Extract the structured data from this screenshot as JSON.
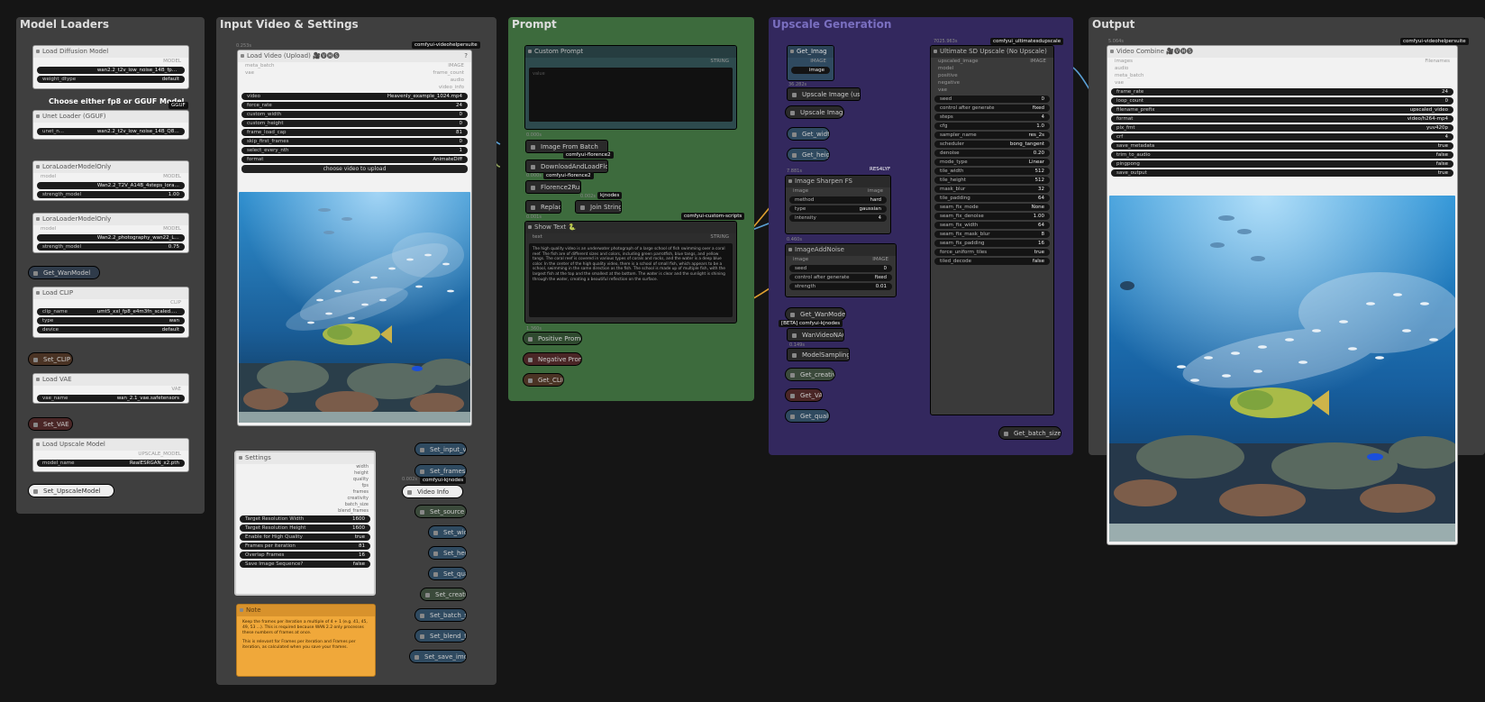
{
  "groups": {
    "model_loaders": "Model Loaders",
    "input_video": "Input Video & Settings",
    "prompt": "Prompt",
    "upscale": "Upscale Generation",
    "output": "Output"
  },
  "model_loaders": {
    "load_diffusion": {
      "title": "Load Diffusion Model",
      "out": "MODEL",
      "unet_name": "wan2.2_t2v_low_noise_14B_fp8_scaled.safetensors",
      "weight_dtype_label": "weight_dtype",
      "weight_dtype": "default"
    },
    "gguf_heading": "Choose either fp8 or GGUF Model",
    "gguf_badge": "GGUF",
    "unet_loader": {
      "title": "Unet Loader (GGUF)",
      "unet_name_label": "unet_n...",
      "unet_name": "wan2.2_t2v_low_noise_14B_Q8_0.gguf"
    },
    "lora1": {
      "title": "LoraLoaderModelOnly",
      "model_label": "model",
      "out": "MODEL",
      "lora_name": "Wan2.2_T2V_A14B_4steps_lora_250928_low_rank",
      "strength_label": "strength_model",
      "strength": "1.00"
    },
    "lora2": {
      "title": "LoraLoaderModelOnly",
      "model_label": "model",
      "out": "MODEL",
      "lora_name": "Wan2.2_photography_wan22_LOW_v1.safetensors",
      "strength_label": "strength_model",
      "strength": "0.75"
    },
    "get_wanmodel": "Get_WanModel",
    "load_clip": {
      "title": "Load CLIP",
      "out": "CLIP",
      "clip_name_label": "clip_name",
      "clip_name": "umt5_xxl_fp8_e4m3fn_scaled.safetensors",
      "type_label": "type",
      "type": "wan",
      "device_label": "device",
      "device": "default"
    },
    "set_clip": "Set_CLIP",
    "load_vae": {
      "title": "Load VAE",
      "out": "VAE",
      "vae_name_label": "vae_name",
      "vae_name": "wan_2.1_vae.safetensors"
    },
    "set_vae": "Set_VAE",
    "load_upscale": {
      "title": "Load Upscale Model",
      "out": "UPSCALE_MODEL",
      "model_name_label": "model_name",
      "model_name": "RealESRGAN_x2.pth"
    },
    "set_upscale": "Set_UpscaleModel"
  },
  "input": {
    "load_video": {
      "time": "0.253s",
      "badge": "comfyui-videohelpersuite",
      "title": "Load Video (Upload) 🎥🅥🅗🅢",
      "help": "?",
      "sock_left": [
        "meta_batch",
        "vae"
      ],
      "sock_right": [
        "IMAGE",
        "frame_count",
        "audio",
        "video_info"
      ],
      "widgets": [
        {
          "k": "video",
          "v": "Heavenly_example_1024.mp4"
        },
        {
          "k": "force_rate",
          "v": "24"
        },
        {
          "k": "custom_width",
          "v": "0"
        },
        {
          "k": "custom_height",
          "v": "0"
        },
        {
          "k": "frame_load_cap",
          "v": "81"
        },
        {
          "k": "skip_first_frames",
          "v": "0"
        },
        {
          "k": "select_every_nth",
          "v": "1"
        },
        {
          "k": "format",
          "v": "AnimateDiff"
        }
      ],
      "upload_label": "choose video to upload"
    },
    "settings": {
      "title": "Settings",
      "outs": [
        "width",
        "height",
        "quality",
        "fps",
        "frames",
        "creativity",
        "batch_size",
        "blend_frames"
      ],
      "widgets": [
        {
          "k": "Target Resolution Width",
          "v": "1600"
        },
        {
          "k": "Target Resolution Height",
          "v": "1600"
        },
        {
          "k": "Enable for High Quality",
          "v": "true"
        },
        {
          "k": "Frames per iteration",
          "v": "81"
        },
        {
          "k": "Overlap Frames",
          "v": "16"
        },
        {
          "k": "Save Image Sequence?",
          "v": "false"
        }
      ]
    },
    "note": {
      "title": "Note",
      "text1": "Keep the frames per iteration a multiple of 4 + 1 (e.g. 41, 45, 49, 53 ...). This is required because WAN 2.2 only processes these numbers of frames at once.",
      "text2": "This is relevant for Frames per iteration and Frames per iteration, as calculated when you save your frames."
    },
    "video_info": {
      "time": "0.002s",
      "badge": "comfyui-kjnodes",
      "title": "Video Info"
    },
    "set_nodes": [
      "Set_input_video",
      "Set_frames_total",
      "Set_source_fps",
      "Set_width",
      "Set_height",
      "Set_quality",
      "Set_creativity",
      "Set_batch_size",
      "Set_blend_frames",
      "Set_save_img_seq"
    ]
  },
  "prompt": {
    "custom_prompt": {
      "title": "Custom Prompt",
      "out": "STRING",
      "value": "value"
    },
    "image_from_batch": {
      "time": "0.000s",
      "title": "Image From Batch",
      "badge": "comfyui-florence2"
    },
    "download_florence": {
      "time": "0.000s",
      "title": "DownloadAndLoadFlorence",
      "badge": "comfyui-florence2"
    },
    "florence_run": {
      "time": "0.000s",
      "title": "Florence2Run"
    },
    "replace": {
      "title": "Replace"
    },
    "join": {
      "time": "0.002s",
      "title": "Join Strings",
      "badge": "kjnodes"
    },
    "show_text": {
      "time": "0.001s",
      "badge": "comfyui-custom-scripts",
      "title": "Show Text 🐍",
      "in": "text",
      "out": "STRING",
      "text": "The high quality video is an underwater photograph of a large school of fish swimming over a coral reef. The fish are of different sizes and colors, including green parrotfish, blue tangs, and yellow tangs. The coral reef is covered in various types of corals and rocks, and the water is a deep blue color. In the center of the high quality video, there is a school of small fish, which appears to be a school, swimming in the same direction as the fish. The school is made up of multiple fish, with the largest fish at the top and the smallest at the bottom. The water is clear and the sunlight is shining through the water, creating a beautiful reflection on the surface."
    },
    "time2": "1.360s",
    "positive": "Positive Prompt",
    "negative": "Negative Prompt",
    "get_clip": "Get_CLIP"
  },
  "upscale": {
    "get_imag": {
      "title": "Get_Imag",
      "out": "IMAGE",
      "image": "image"
    },
    "time": "36.282s",
    "upscale_using": "Upscale Image (using",
    "upscale_image": "Upscale Image",
    "get_width": "Get_width",
    "get_height": "Get_height",
    "time2": "7.881s",
    "res_badge": "RES4LYF",
    "sharpen": {
      "title": "Image Sharpen FS",
      "in": "image",
      "out": "image",
      "widgets": [
        {
          "k": "method",
          "v": "hard"
        },
        {
          "k": "type",
          "v": "gaussian"
        },
        {
          "k": "intensity",
          "v": "4"
        }
      ]
    },
    "time3": "0.460s",
    "add_noise": {
      "title": "ImageAddNoise",
      "in": "image",
      "out": "IMAGE",
      "widgets": [
        {
          "k": "seed",
          "v": "0"
        },
        {
          "k": "control after generate",
          "v": "fixed"
        },
        {
          "k": "strength",
          "v": "0.01"
        }
      ]
    },
    "get_wanmodel": "Get_WanModel",
    "beta_badge": "[BETA] comfyui-kjnodes",
    "wan_video_nag": "WanVideoNAG",
    "time4": "0.149s",
    "model_sampling": "ModelSamplingSD3",
    "get_creativity": "Get_creativity",
    "get_vae": "Get_VAE",
    "get_quality": "Get_quality",
    "usdu": {
      "time": "7025.963s",
      "badge": "comfyui_ultimatesdupscale",
      "title": "Ultimate SD Upscale (No Upscale)",
      "ins": [
        "upscaled_image",
        "model",
        "positive",
        "negative",
        "vae"
      ],
      "out": "IMAGE",
      "widgets": [
        {
          "k": "seed",
          "v": "0"
        },
        {
          "k": "control after generate",
          "v": "fixed"
        },
        {
          "k": "steps",
          "v": "4"
        },
        {
          "k": "cfg",
          "v": "1.0"
        },
        {
          "k": "sampler_name",
          "v": "res_2s"
        },
        {
          "k": "scheduler",
          "v": "bong_tangent"
        },
        {
          "k": "denoise",
          "v": "0.20"
        },
        {
          "k": "mode_type",
          "v": "Linear"
        },
        {
          "k": "tile_width",
          "v": "512"
        },
        {
          "k": "tile_height",
          "v": "512"
        },
        {
          "k": "mask_blur",
          "v": "32"
        },
        {
          "k": "tile_padding",
          "v": "64"
        },
        {
          "k": "seam_fix_mode",
          "v": "None"
        },
        {
          "k": "seam_fix_denoise",
          "v": "1.00"
        },
        {
          "k": "seam_fix_width",
          "v": "64"
        },
        {
          "k": "seam_fix_mask_blur",
          "v": "8"
        },
        {
          "k": "seam_fix_padding",
          "v": "16"
        },
        {
          "k": "force_uniform_tiles",
          "v": "true"
        },
        {
          "k": "tiled_decode",
          "v": "false"
        }
      ]
    },
    "get_batch": "Get_batch_size"
  },
  "output": {
    "time": "5.064s",
    "badge": "comfyui-videohelpersuite",
    "title": "Video Combine 🎥🅥🅗🅢",
    "ins": [
      "images",
      "audio",
      "meta_batch",
      "vae"
    ],
    "out": "Filenames",
    "widgets": [
      {
        "k": "frame_rate",
        "v": "24"
      },
      {
        "k": "loop_count",
        "v": "0"
      },
      {
        "k": "filename_prefix",
        "v": "upscaled_video"
      },
      {
        "k": "format",
        "v": "video/h264-mp4"
      },
      {
        "k": "pix_fmt",
        "v": "yuv420p"
      },
      {
        "k": "crf",
        "v": "4"
      },
      {
        "k": "save_metadata",
        "v": "true"
      },
      {
        "k": "trim_to_audio",
        "v": "false"
      },
      {
        "k": "pingpong",
        "v": "false"
      },
      {
        "k": "save_output",
        "v": "true"
      }
    ]
  },
  "colors": {
    "bg": "#151515",
    "group_gray": "#3f3f3f",
    "group_green": "#3d6b3d",
    "group_purple": "#33285e",
    "note_orange": "#f0a83a",
    "link_orange": "#e0a030",
    "link_blue": "#5a9fd4",
    "link_olive": "#8ea05a"
  }
}
